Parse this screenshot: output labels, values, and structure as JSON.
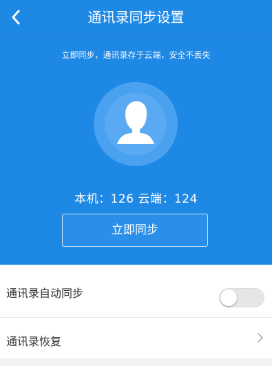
{
  "header": {
    "title": "通讯录同步设置",
    "back_icon": "chevron-left-icon"
  },
  "hero": {
    "subtitle": "立即同步，通讯录存于云端，安全不丢失",
    "avatar_icon": "user-avatar-icon",
    "counts": "本机：126  云端：124",
    "sync_button_label": "立即同步"
  },
  "settings": {
    "auto_sync_label": "通讯录自动同步",
    "auto_sync_enabled": false,
    "restore_label": "通讯录恢复",
    "restore_icon": "chevron-right-icon"
  },
  "colors": {
    "accent": "#1e88e5"
  }
}
